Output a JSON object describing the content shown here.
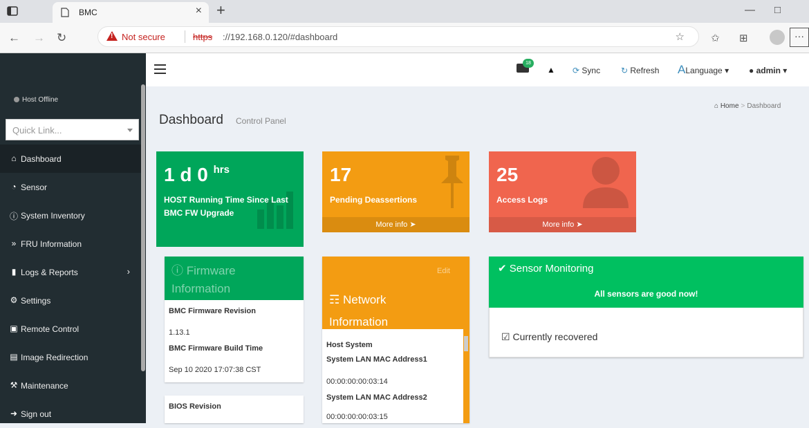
{
  "browser": {
    "tab_title": "BMC",
    "tab_close": "×",
    "new_tab": "+",
    "not_secure": "Not secure",
    "url_protocol": "https",
    "url_rest": "://192.168.0.120/#dashboard",
    "minimize": "—",
    "restore": "🗗",
    "more": "···"
  },
  "sidebar": {
    "host_status": "Host Offline",
    "quicklink_placeholder": "Quick Link...",
    "items": [
      {
        "label": "Dashboard",
        "icon": "home-icon",
        "active": true
      },
      {
        "label": "Sensor",
        "icon": "gauge-icon"
      },
      {
        "label": "System Inventory",
        "icon": "info-circle-icon"
      },
      {
        "label": "FRU Information",
        "icon": "double-chevron-icon"
      },
      {
        "label": "Logs & Reports",
        "icon": "bar-chart-icon",
        "arrow": "›"
      },
      {
        "label": "Settings",
        "icon": "gear-icon"
      },
      {
        "label": "Remote Control",
        "icon": "monitor-icon"
      },
      {
        "label": "Image Redirection",
        "icon": "drive-icon"
      },
      {
        "label": "Maintenance",
        "icon": "wrench-icon"
      },
      {
        "label": "Sign out",
        "icon": "sign-out-icon"
      }
    ]
  },
  "topnav": {
    "notification_count": "18",
    "sync": "Sync",
    "refresh": "Refresh",
    "language": "Language",
    "user": "admin"
  },
  "header": {
    "title": "Dashboard",
    "subtitle": "Control Panel",
    "breadcrumb_home": "Home",
    "breadcrumb_current": "Dashboard"
  },
  "boxes": {
    "running": {
      "value": "1 d 0",
      "unit": "hrs",
      "label_line1": "HOST Running Time Since Last",
      "label_line2": "BMC FW Upgrade",
      "color": "#00a65a"
    },
    "deassertions": {
      "value": "17",
      "label": "Pending Deassertions",
      "more": "More info",
      "color": "#f39c12"
    },
    "access": {
      "value": "25",
      "label": "Access Logs",
      "more": "More info",
      "color": "#f0654e"
    }
  },
  "firmware": {
    "title_line1": "Firmware",
    "title_line2": "Information",
    "bmc_rev_label": "BMC Firmware Revision",
    "bmc_rev_value": "1.13.1",
    "build_time_label": "BMC Firmware Build Time",
    "build_time_value": "Sep 10 2020 17:07:38 CST",
    "bios_label": "BIOS Revision"
  },
  "network": {
    "edit": "Edit",
    "title_line1": "Network",
    "title_line2": "Information",
    "host_system": "Host System",
    "mac1_label": "System LAN MAC Address1",
    "mac1_value": "00:00:00:00:03:14",
    "mac2_label": "System LAN MAC Address2",
    "mac2_value": "00:00:00:00:03:15"
  },
  "sensor": {
    "title": "Sensor Monitoring",
    "all_good": "All sensors are good now!",
    "recovered": "Currently recovered"
  }
}
